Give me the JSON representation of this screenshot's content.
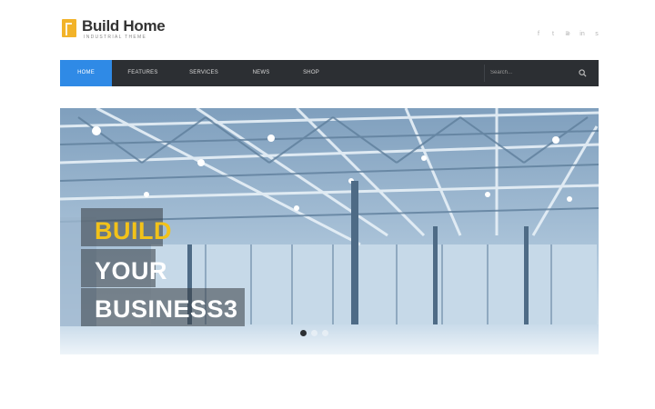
{
  "brand": {
    "name": "Build Home",
    "tagline": "INDUSTRIAL THEME",
    "accent_color": "#f2b329"
  },
  "social": [
    {
      "icon": "facebook-icon",
      "glyph": "f"
    },
    {
      "icon": "twitter-icon",
      "glyph": "t"
    },
    {
      "icon": "rss-icon",
      "glyph": "⋑"
    },
    {
      "icon": "linkedin-icon",
      "glyph": "in"
    },
    {
      "icon": "skype-icon",
      "glyph": "s"
    }
  ],
  "nav": {
    "items": [
      {
        "label": "HOME",
        "active": true
      },
      {
        "label": "FEATURES",
        "active": false
      },
      {
        "label": "SERVICES",
        "active": false
      },
      {
        "label": "NEWS",
        "active": false
      },
      {
        "label": "SHOP",
        "active": false
      }
    ],
    "search_placeholder": "Search...",
    "active_color": "#2f8ae6",
    "bar_color": "#2c2f33"
  },
  "hero": {
    "line1": "BUILD",
    "line2": "YOUR",
    "line3": "BUSINESS3",
    "highlight_color": "#f2c21a",
    "slides": 3,
    "active_slide": 1
  }
}
